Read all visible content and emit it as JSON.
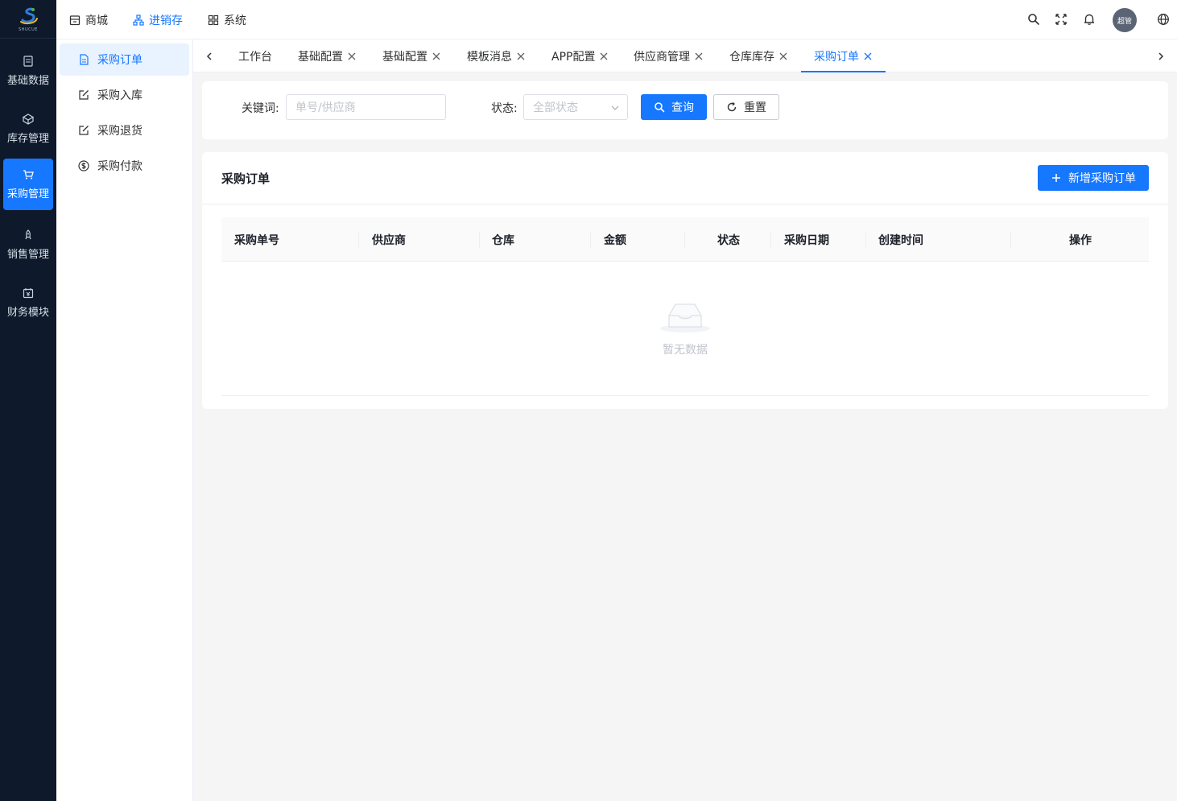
{
  "brand": {
    "logo_text": "SHUCUE"
  },
  "rail": {
    "items": [
      {
        "label": "基础数据",
        "icon": "table-icon"
      },
      {
        "label": "库存管理",
        "icon": "box-icon"
      },
      {
        "label": "采购管理",
        "icon": "cart-icon",
        "active": true
      },
      {
        "label": "销售管理",
        "icon": "rocket-icon"
      },
      {
        "label": "财务模块",
        "icon": "finance-icon"
      }
    ]
  },
  "topnav": {
    "items": [
      {
        "label": "商城",
        "icon": "store-icon"
      },
      {
        "label": "进销存",
        "icon": "sitemap-icon",
        "active": true
      },
      {
        "label": "系统",
        "icon": "grid-icon"
      }
    ]
  },
  "user": {
    "avatar_text": "超管"
  },
  "sidebar": {
    "items": [
      {
        "label": "采购订单",
        "icon": "document-icon",
        "active": true
      },
      {
        "label": "采购入库",
        "icon": "edit-icon"
      },
      {
        "label": "采购退货",
        "icon": "edit-icon"
      },
      {
        "label": "采购付款",
        "icon": "dollar-icon"
      }
    ]
  },
  "tabs": {
    "items": [
      {
        "label": "工作台",
        "closable": false
      },
      {
        "label": "基础配置",
        "closable": true
      },
      {
        "label": "基础配置",
        "closable": true
      },
      {
        "label": "模板消息",
        "closable": true
      },
      {
        "label": "APP配置",
        "closable": true
      },
      {
        "label": "供应商管理",
        "closable": true
      },
      {
        "label": "仓库库存",
        "closable": true
      },
      {
        "label": "采购订单",
        "closable": true,
        "active": true
      }
    ]
  },
  "filter": {
    "keyword_label": "关键词:",
    "keyword_placeholder": "单号/供应商",
    "status_label": "状态:",
    "status_placeholder": "全部状态",
    "search_label": "查询",
    "reset_label": "重置"
  },
  "list": {
    "title": "采购订单",
    "add_label": "新增采购订单",
    "columns": [
      "采购单号",
      "供应商",
      "仓库",
      "金额",
      "状态",
      "采购日期",
      "创建时间",
      "操作"
    ],
    "rows": [],
    "empty_text": "暂无数据"
  },
  "colors": {
    "accent": "#1677ff",
    "rail_bg": "#0e1a2b"
  }
}
